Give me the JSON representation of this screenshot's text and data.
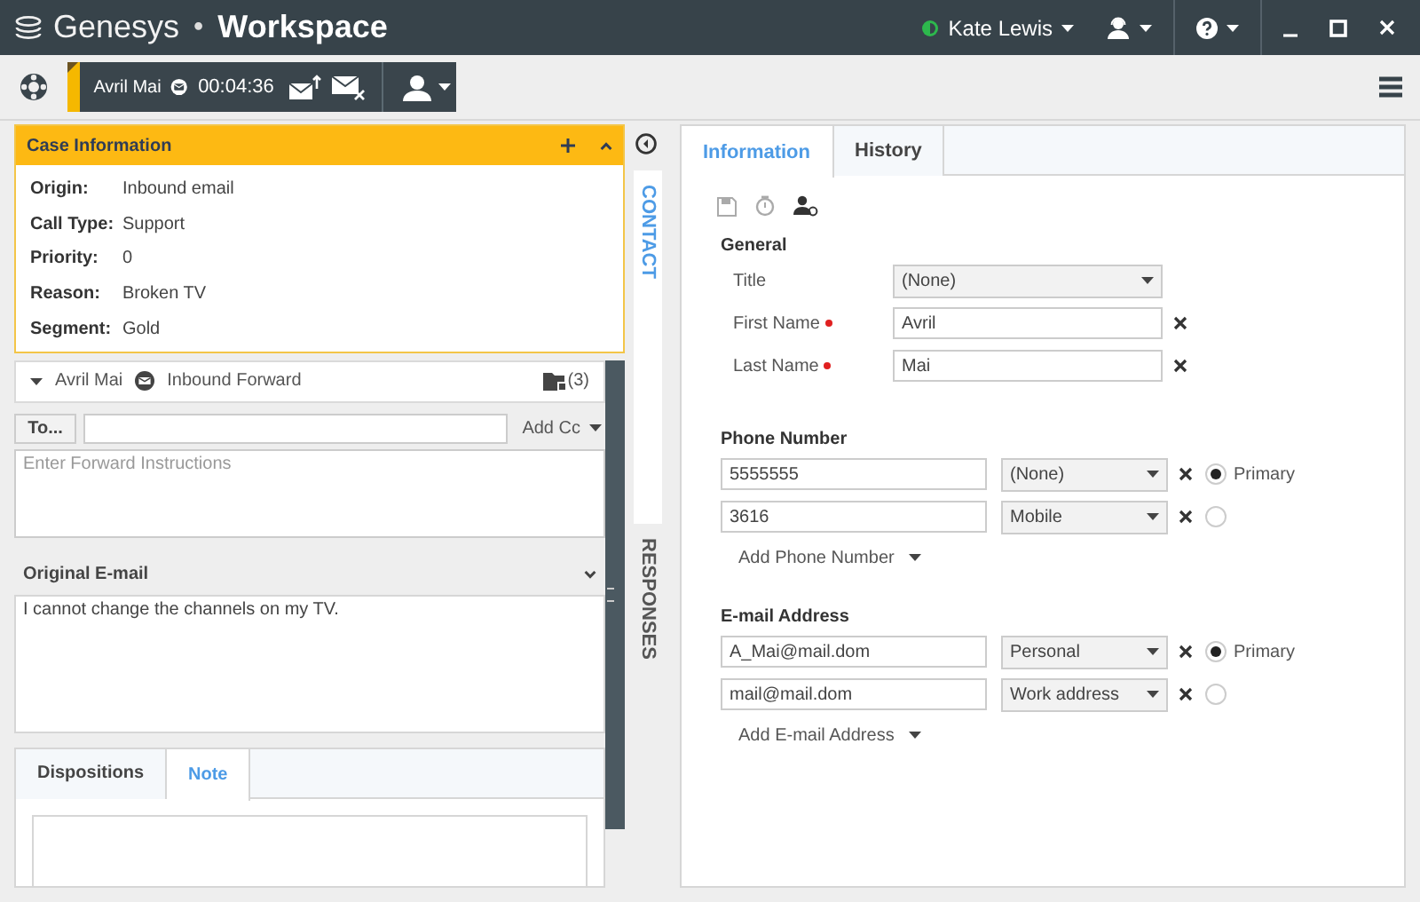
{
  "title_bar": {
    "brand": "Genesys",
    "separator": "•",
    "app": "Workspace",
    "agent": "Kate Lewis"
  },
  "interaction_bar": {
    "contact": "Avril Mai",
    "timer": "00:04:36"
  },
  "case_information": {
    "title": "Case Information",
    "expanded": true,
    "fields": [
      {
        "label": "Origin:",
        "value": "Inbound email"
      },
      {
        "label": "Call Type:",
        "value": "Support"
      },
      {
        "label": "Priority:",
        "value": "0"
      },
      {
        "label": "Reason:",
        "value": "Broken TV"
      },
      {
        "label": "Segment:",
        "value": "Gold"
      }
    ]
  },
  "interaction": {
    "contact": "Avril Mai",
    "type": "Inbound Forward",
    "attachments": "(3)",
    "expanded": true
  },
  "forward": {
    "to_button": "To...",
    "add_cc": "Add Cc",
    "placeholder": "Enter Forward Instructions"
  },
  "original_email": {
    "title": "Original E-mail",
    "expanded": true,
    "body": "I cannot change the channels on my TV."
  },
  "bottom_tabs": [
    {
      "label": "Dispositions",
      "selected": false
    },
    {
      "label": "Note",
      "selected": true
    }
  ],
  "side_tabs": [
    {
      "label": "CONTACT",
      "selected": true
    },
    {
      "label": "RESPONSES",
      "selected": false
    }
  ],
  "contact_tabs": [
    {
      "label": "Information",
      "selected": true
    },
    {
      "label": "History",
      "selected": false
    }
  ],
  "general": {
    "title": "General",
    "fields": [
      {
        "kind": "select",
        "label": "Title",
        "value": "(None)",
        "required": false
      },
      {
        "kind": "text",
        "label": "First Name",
        "value": "Avril",
        "required": true
      },
      {
        "kind": "text",
        "label": "Last Name",
        "value": "Mai",
        "required": true
      }
    ]
  },
  "phone": {
    "title": "Phone Number",
    "primary_label": "Primary",
    "add": "Add Phone Number",
    "entries": [
      {
        "value": "5555555",
        "type": "(None)",
        "selected": true
      },
      {
        "value": "3616",
        "type": "Mobile",
        "selected": false
      }
    ]
  },
  "email": {
    "title": "E-mail Address",
    "primary_label": "Primary",
    "add": "Add E-mail Address",
    "entries": [
      {
        "value": "A_Mai@mail.dom",
        "type": "Personal",
        "selected": true
      },
      {
        "value": "mail@mail.dom",
        "type": "Work address",
        "selected": false
      }
    ]
  }
}
